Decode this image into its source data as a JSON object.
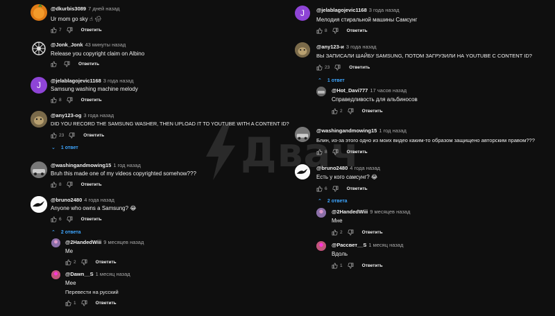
{
  "ui": {
    "reply_label": "Ответить"
  },
  "watermark": {
    "text": "Двач"
  },
  "left": [
    {
      "author": "@dkurbis3089",
      "time": "7 дней назад",
      "text": "Ur mom go sky ☝ 🌧",
      "likes": "7",
      "avatar": "orange"
    },
    {
      "author": "@Jonk_Jonk",
      "time": "43 минуты назад",
      "text": "Release you copyright claim on Albino",
      "likes": "",
      "avatar": "empire"
    },
    {
      "author": "@jelablagojevic1168",
      "time": "3 года назад",
      "text": "Samsung washing machine melody",
      "likes": "8",
      "avatar": "J"
    },
    {
      "author": "@any123-og",
      "time": "3 года назад",
      "text": "DID YOU RECORD THE SAMSUNG WASHER, THEN UPLOAD IT TO YOUTUBE WITH A CONTENT ID?",
      "likes": "23",
      "avatar": "cat",
      "replies": "1 ответ"
    },
    {
      "author": "@washingandmowing15",
      "time": "1 год назад",
      "text": "Bruh this made one of my videos copyrighted somehow???",
      "likes": "8",
      "avatar": "car"
    },
    {
      "author": "@bruno2480",
      "time": "4 года назад",
      "text": "Anyone who owns a Samsung? 😂",
      "likes": "6",
      "avatar": "bird",
      "replies": "2 ответа"
    },
    {
      "author": "@2HandedWiii",
      "time": "9 месяцев назад",
      "text": "Me",
      "likes": "2",
      "avatar": "small"
    },
    {
      "author": "@Dawn__S",
      "time": "1 месяц назад",
      "text": "Mee",
      "text2": "Перевести на русский",
      "likes": "1",
      "avatar": "small2"
    }
  ],
  "right": [
    {
      "author": "@jelablagojevic1168",
      "time": "3 года назад",
      "text": "Мелодия стиральной машины Самсунг",
      "likes": "8",
      "avatar": "J"
    },
    {
      "author": "@any123-и",
      "time": "3 года назад",
      "text": "ВЫ ЗАПИСАЛИ ШАЙБУ SAMSUNG, ПОТОМ ЗАГРУЗИЛИ НА YOUTUBE С CONTENT ID?",
      "likes": "23",
      "avatar": "cat",
      "replies": "1 ответ"
    },
    {
      "author": "@Hot_Davi777",
      "time": "17 часов назад",
      "text": "Справедливость для альбиносов",
      "likes": "2",
      "avatar": "car2"
    },
    {
      "author": "@washingandmowing15",
      "time": "1 год назад",
      "text": "Блин, из-за этого одно из моих видео каким-то образом защищено авторским правом???",
      "likes": "8",
      "avatar": "car"
    },
    {
      "author": "@bruno2480",
      "time": "4 года назад",
      "text": "Есть у кого самсунг? 😂",
      "likes": "6",
      "avatar": "bird",
      "replies": "2 ответа"
    },
    {
      "author": "@2HandedWiii",
      "time": "9 месяцев назад",
      "text": "Мне",
      "likes": "2",
      "avatar": "small"
    },
    {
      "author": "@Рассвет__S",
      "time": "1 месяц назад",
      "text": "Вдоль",
      "likes": "1",
      "avatar": "small2"
    }
  ]
}
